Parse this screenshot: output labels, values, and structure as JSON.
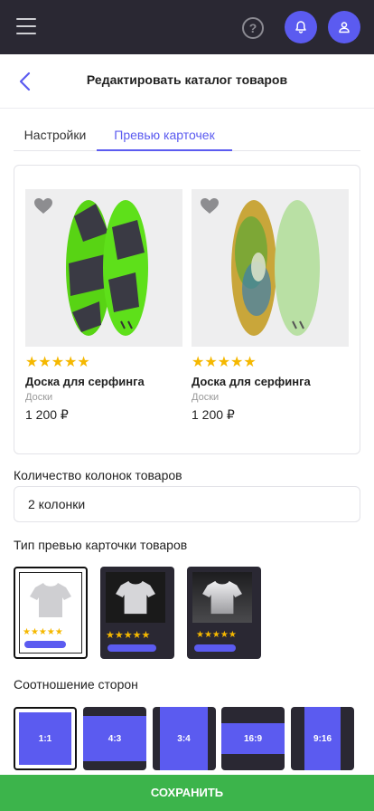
{
  "topbar": {
    "help_glyph": "?"
  },
  "header": {
    "title": "Редактировать каталог товаров"
  },
  "tabs": [
    {
      "label": "Настройки",
      "active": false
    },
    {
      "label": "Превью карточек",
      "active": true
    }
  ],
  "preview": {
    "cards": [
      {
        "stars": "★★★★★",
        "name": "Доска для серфинга",
        "category": "Доски",
        "price": "1 200 ₽"
      },
      {
        "stars": "★★★★★",
        "name": "Доска для серфинга",
        "category": "Доски",
        "price": "1 200 ₽"
      }
    ]
  },
  "columns": {
    "label": "Количество колонок товаров",
    "value": "2 колонки"
  },
  "card_type": {
    "label": "Тип превью карточки товаров",
    "options_stars": "★★★★★",
    "selected_index": 0
  },
  "aspect": {
    "label": "Соотношение сторон",
    "options": [
      "1:1",
      "4:3",
      "3:4",
      "16:9",
      "9:16"
    ],
    "selected": "1:1"
  },
  "save_label": "СОХРАНИТЬ",
  "colors": {
    "accent": "#5b5bf0",
    "dark": "#2a2833",
    "save": "#3cb44b",
    "star": "#f5b800"
  }
}
